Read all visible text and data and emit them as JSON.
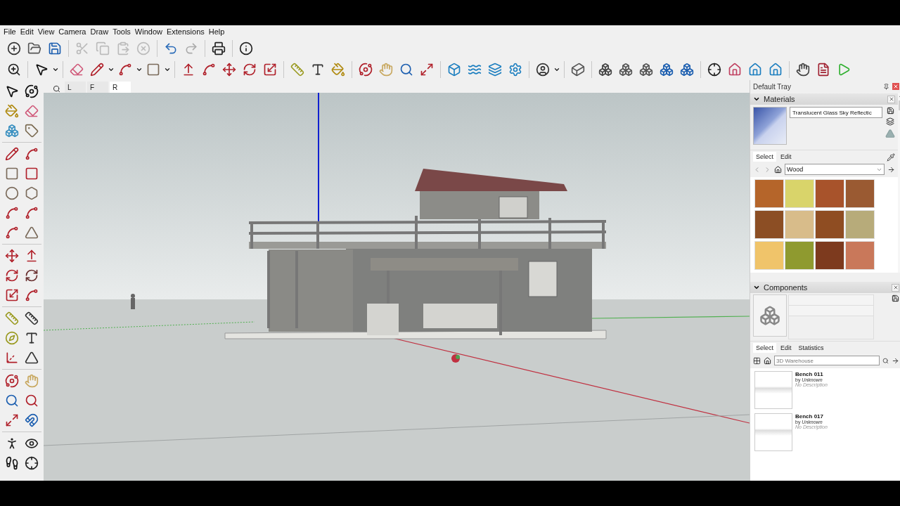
{
  "menu": [
    "File",
    "Edit",
    "View",
    "Camera",
    "Draw",
    "Tools",
    "Window",
    "Extensions",
    "Help"
  ],
  "scene_tabs": [
    {
      "label": "L",
      "selected": false
    },
    {
      "label": "F",
      "selected": false
    },
    {
      "label": "R",
      "selected": true
    }
  ],
  "tray": {
    "title": "Default Tray",
    "materials": {
      "title": "Materials",
      "name": "Translucent Glass Sky Reflectic",
      "tabs": [
        {
          "label": "Select",
          "selected": true
        },
        {
          "label": "Edit",
          "selected": false
        }
      ],
      "library": "Wood",
      "swatches": [
        {
          "color": "#b5652a"
        },
        {
          "color": "#d9d46a"
        },
        {
          "color": "#a8532b"
        },
        {
          "color": "#9a5a32"
        },
        {
          "color": "#8c4e24"
        },
        {
          "color": "#d8bc8a"
        },
        {
          "color": "#8f4d22"
        },
        {
          "color": "#b7ab7a"
        },
        {
          "color": "#f0c46a"
        },
        {
          "color": "#8f9a2f"
        },
        {
          "color": "#7d3a1e"
        },
        {
          "color": "#c9785a"
        }
      ]
    },
    "components": {
      "title": "Components",
      "tabs": [
        {
          "label": "Select",
          "selected": true
        },
        {
          "label": "Edit",
          "selected": false
        },
        {
          "label": "Statistics",
          "selected": false
        }
      ],
      "search": {
        "placeholder": "3D Warehouse"
      },
      "items": [
        {
          "name": "Bench 011",
          "author": "by *Unknown*",
          "description": "No Description"
        },
        {
          "name": "Bench 017",
          "author": "by *Unknown*",
          "description": "No Description"
        }
      ]
    }
  }
}
